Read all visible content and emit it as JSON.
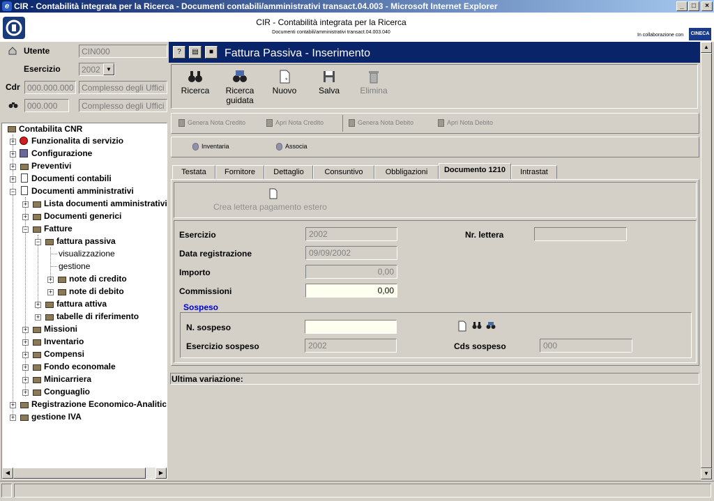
{
  "window": {
    "title": "CIR - Contabilità integrata per la Ricerca - Documenti contabili/amministrativi transact.04.003 - Microsoft Internet Explorer",
    "btn_min": "_",
    "btn_max": "□",
    "btn_close": "×"
  },
  "header": {
    "title": "CIR - Contabilità integrata per la Ricerca",
    "subtitle": "Documenti contabili/amministrativi transact.04.003.040",
    "collab": "In collaborazione con",
    "cineca": "CINECA"
  },
  "left": {
    "utente_label": "Utente",
    "utente_value": "CIN000",
    "esercizio_label": "Esercizio",
    "esercizio_value": "2002",
    "cdr_label": "Cdr",
    "cdr_code": "000.000.000",
    "cdr_desc": "Complesso degli Uffici",
    "cds_code": "000.000",
    "cds_desc": "Complesso degli Uffici"
  },
  "tree": [
    {
      "label": "Contabilita CNR"
    },
    {
      "label": "Funzionalita di servizio"
    },
    {
      "label": "Configurazione"
    },
    {
      "label": "Preventivi"
    },
    {
      "label": "Documenti contabili"
    },
    {
      "label": "Documenti amministrativi"
    },
    {
      "label": "Lista documenti amministrativi"
    },
    {
      "label": "Documenti generici"
    },
    {
      "label": "Fatture"
    },
    {
      "label": "fattura passiva"
    },
    {
      "label": "visualizzazione"
    },
    {
      "label": "gestione"
    },
    {
      "label": "note di credito"
    },
    {
      "label": "note di debito"
    },
    {
      "label": "fattura attiva"
    },
    {
      "label": "tabelle di riferimento"
    },
    {
      "label": "Missioni"
    },
    {
      "label": "Inventario"
    },
    {
      "label": "Compensi"
    },
    {
      "label": "Fondo economale"
    },
    {
      "label": "Minicarriera"
    },
    {
      "label": "Conguaglio"
    },
    {
      "label": "Registrazione Economico-Analitica"
    },
    {
      "label": "gestione IVA"
    }
  ],
  "form": {
    "title": "Fattura Passiva - Inserimento",
    "toolbar": {
      "ricerca": "Ricerca",
      "ricerca_guidata_1": "Ricerca",
      "ricerca_guidata_2": "guidata",
      "nuovo": "Nuovo",
      "salva": "Salva",
      "elimina": "Elimina"
    },
    "note_buttons": {
      "genera_credito": "Genera Nota Credito",
      "apri_credito": "Apri Nota Credito",
      "genera_debito": "Genera Nota Debito",
      "apri_debito": "Apri Nota Debito"
    },
    "inventario": "Inventaria",
    "associa": "Associa",
    "tabs": [
      "Testata",
      "Fornitore",
      "Dettaglio",
      "Consuntivo",
      "Obbligazioni",
      "Documento 1210",
      "Intrastat"
    ],
    "crea_lettera": "Crea lettera pagamento estero",
    "fields": {
      "esercizio_label": "Esercizio",
      "esercizio_value": "2002",
      "nr_lettera_label": "Nr. lettera",
      "nr_lettera_value": "",
      "data_reg_label": "Data registrazione",
      "data_reg_value": "09/09/2002",
      "importo_label": "Importo",
      "importo_value": "0,00",
      "commissioni_label": "Commissioni",
      "commissioni_value": "0,00"
    },
    "sospeso": {
      "title": "Sospeso",
      "n_sospeso_label": "N. sospeso",
      "n_sospeso_value": "",
      "esercizio_sospeso_label": "Esercizio sospeso",
      "esercizio_sospeso_value": "2002",
      "cds_sospeso_label": "Cds sospeso",
      "cds_sospeso_value": "000"
    },
    "ultima_variazione": "Ultima variazione:"
  }
}
